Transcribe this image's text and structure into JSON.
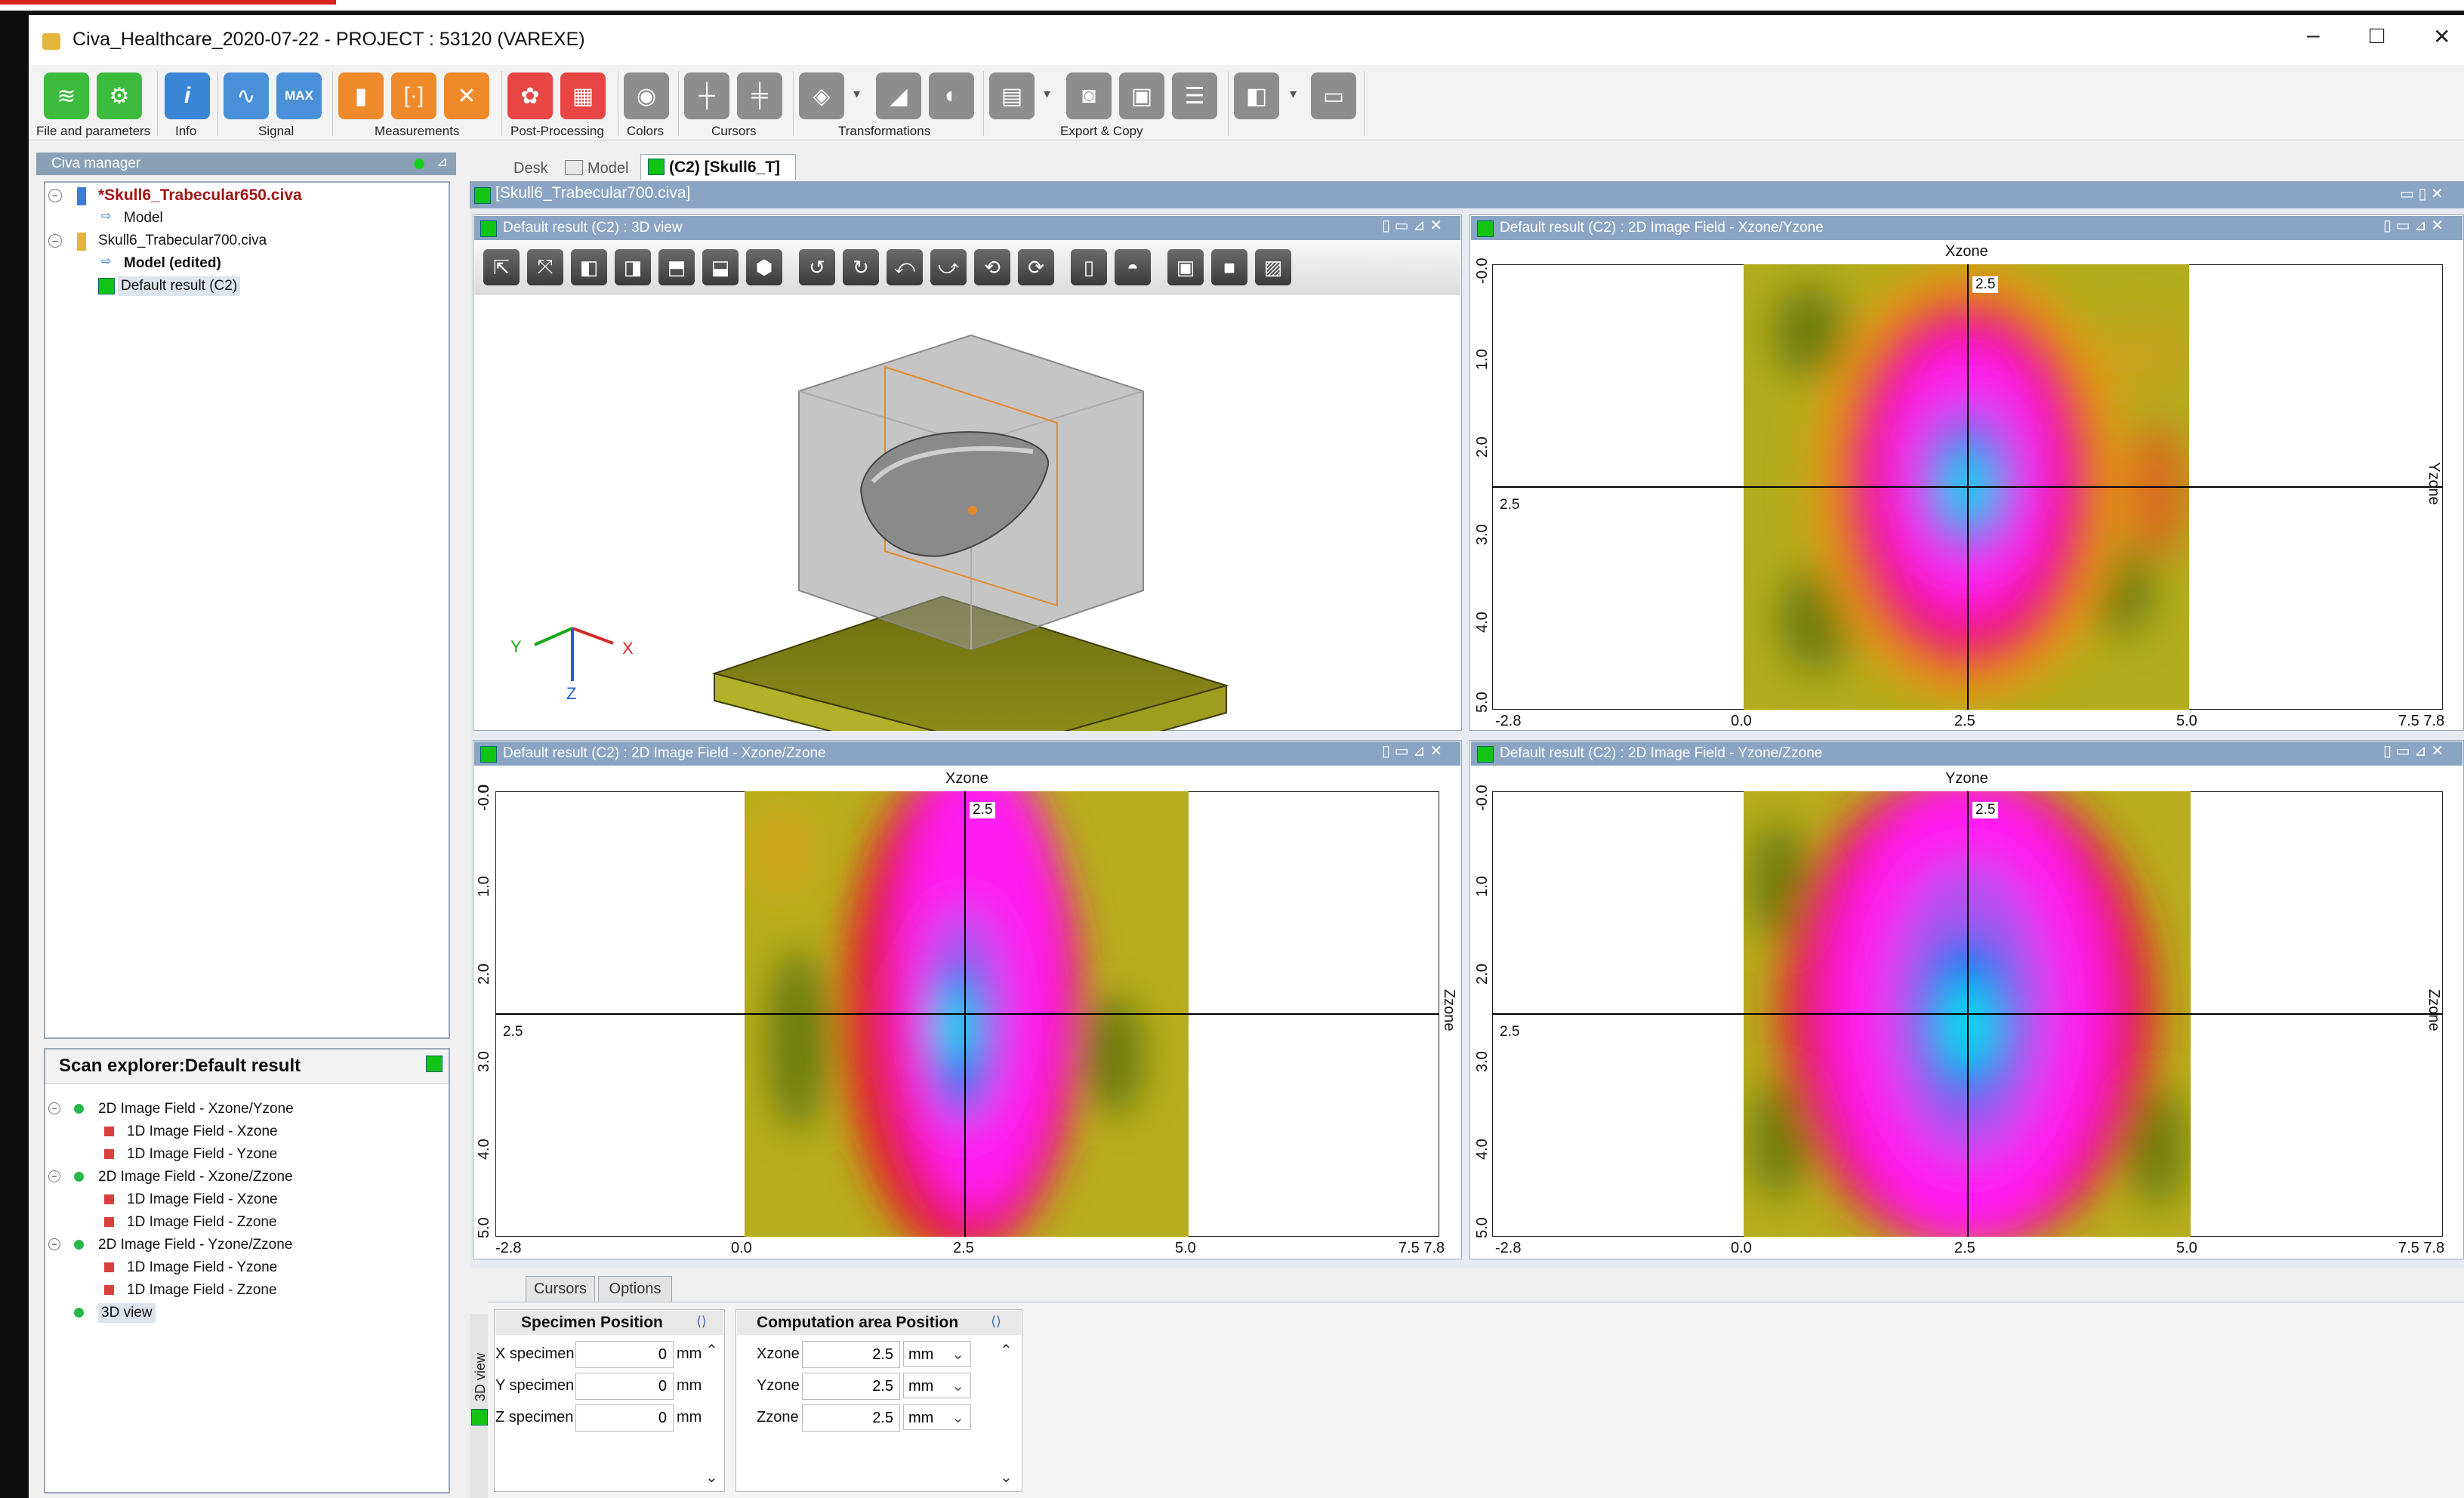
{
  "window": {
    "title": "Civa_Healthcare_2020-07-22 - PROJECT : 53120 (VAREXE)",
    "controls": {
      "minimize": "–",
      "maximize": "□",
      "close": "✕"
    }
  },
  "toolbar": {
    "groups": {
      "file": "File and parameters",
      "info": "Info",
      "signal": "Signal",
      "measurements": "Measurements",
      "post": "Post-Processing",
      "colors": "Colors",
      "cursors": "Cursors",
      "transformations": "Transformations",
      "export": "Export & Copy"
    },
    "signal_max_label": "MAX",
    "info_glyph": "i"
  },
  "civa_manager": {
    "title": "Civa manager",
    "tree": [
      {
        "label": "*Skull6_Trabecular650.civa"
      },
      {
        "label": "Model"
      },
      {
        "label": "Skull6_Trabecular700.civa"
      },
      {
        "label": "Model (edited)"
      },
      {
        "label": "Default result (C2)"
      }
    ]
  },
  "tabs": {
    "desk": "Desk",
    "model": "Model",
    "active": "(C2) [Skull6_T]"
  },
  "doc_title": "[Skull6_Trabecular700.civa]",
  "scan_explorer": {
    "title": "Scan explorer:Default result",
    "items": [
      "2D Image Field - Xzone/Yzone",
      "1D Image Field - Xzone",
      "1D Image Field - Yzone",
      "2D Image Field - Xzone/Zzone",
      "1D Image Field - Xzone",
      "1D Image Field - Zzone",
      "2D Image Field - Yzone/Zzone",
      "1D Image Field - Yzone",
      "1D Image Field - Zzone",
      "3D view"
    ]
  },
  "views": {
    "v3d": {
      "title": "Default result (C2) : 3D view",
      "axes": {
        "x": "X",
        "y": "Y",
        "z": "Z"
      }
    },
    "xy": {
      "title": "Default result (C2) : 2D Image Field - Xzone/Yzone",
      "top_axis": "Xzone",
      "right_axis": "Yzone",
      "cursor_top": "2.5",
      "cursor_left": "2.5"
    },
    "xz": {
      "title": "Default result (C2) : 2D Image Field - Xzone/Zzone",
      "top_axis": "Xzone",
      "right_axis": "Zzone",
      "cursor_top": "2.5",
      "cursor_left": "2.5"
    },
    "yz": {
      "title": "Default result (C2) : 2D Image Field - Yzone/Zzone",
      "top_axis": "Yzone",
      "right_axis": "Zzone",
      "cursor_top": "2.5",
      "cursor_left": "2.5"
    },
    "x_ticks": [
      "-2.8",
      "0.0",
      "2.5",
      "5.0",
      "7.5 7.8"
    ],
    "y_ticks": [
      "-0.0",
      "1.0",
      "2.0",
      "3.0",
      "4.0",
      "5.0"
    ],
    "y_tick_top_xz": "0"
  },
  "bottom": {
    "tabs": {
      "cursors": "Cursors",
      "options": "Options"
    },
    "side_label": "3D view",
    "specimen": {
      "title": "Specimen Position",
      "rows": [
        {
          "label": "X specimen",
          "value": "0",
          "unit": "mm"
        },
        {
          "label": "Y specimen",
          "value": "0",
          "unit": "mm"
        },
        {
          "label": "Z specimen",
          "value": "0",
          "unit": "mm"
        }
      ]
    },
    "computation": {
      "title": "Computation area Position",
      "rows": [
        {
          "label": "Xzone",
          "value": "2.5",
          "unit": "mm"
        },
        {
          "label": "Yzone",
          "value": "2.5",
          "unit": "mm"
        },
        {
          "label": "Zzone",
          "value": "2.5",
          "unit": "mm"
        }
      ]
    }
  },
  "colors": {
    "accent_header": "#8aa4c4",
    "green": "#13c313",
    "red_title": "#a31515"
  }
}
